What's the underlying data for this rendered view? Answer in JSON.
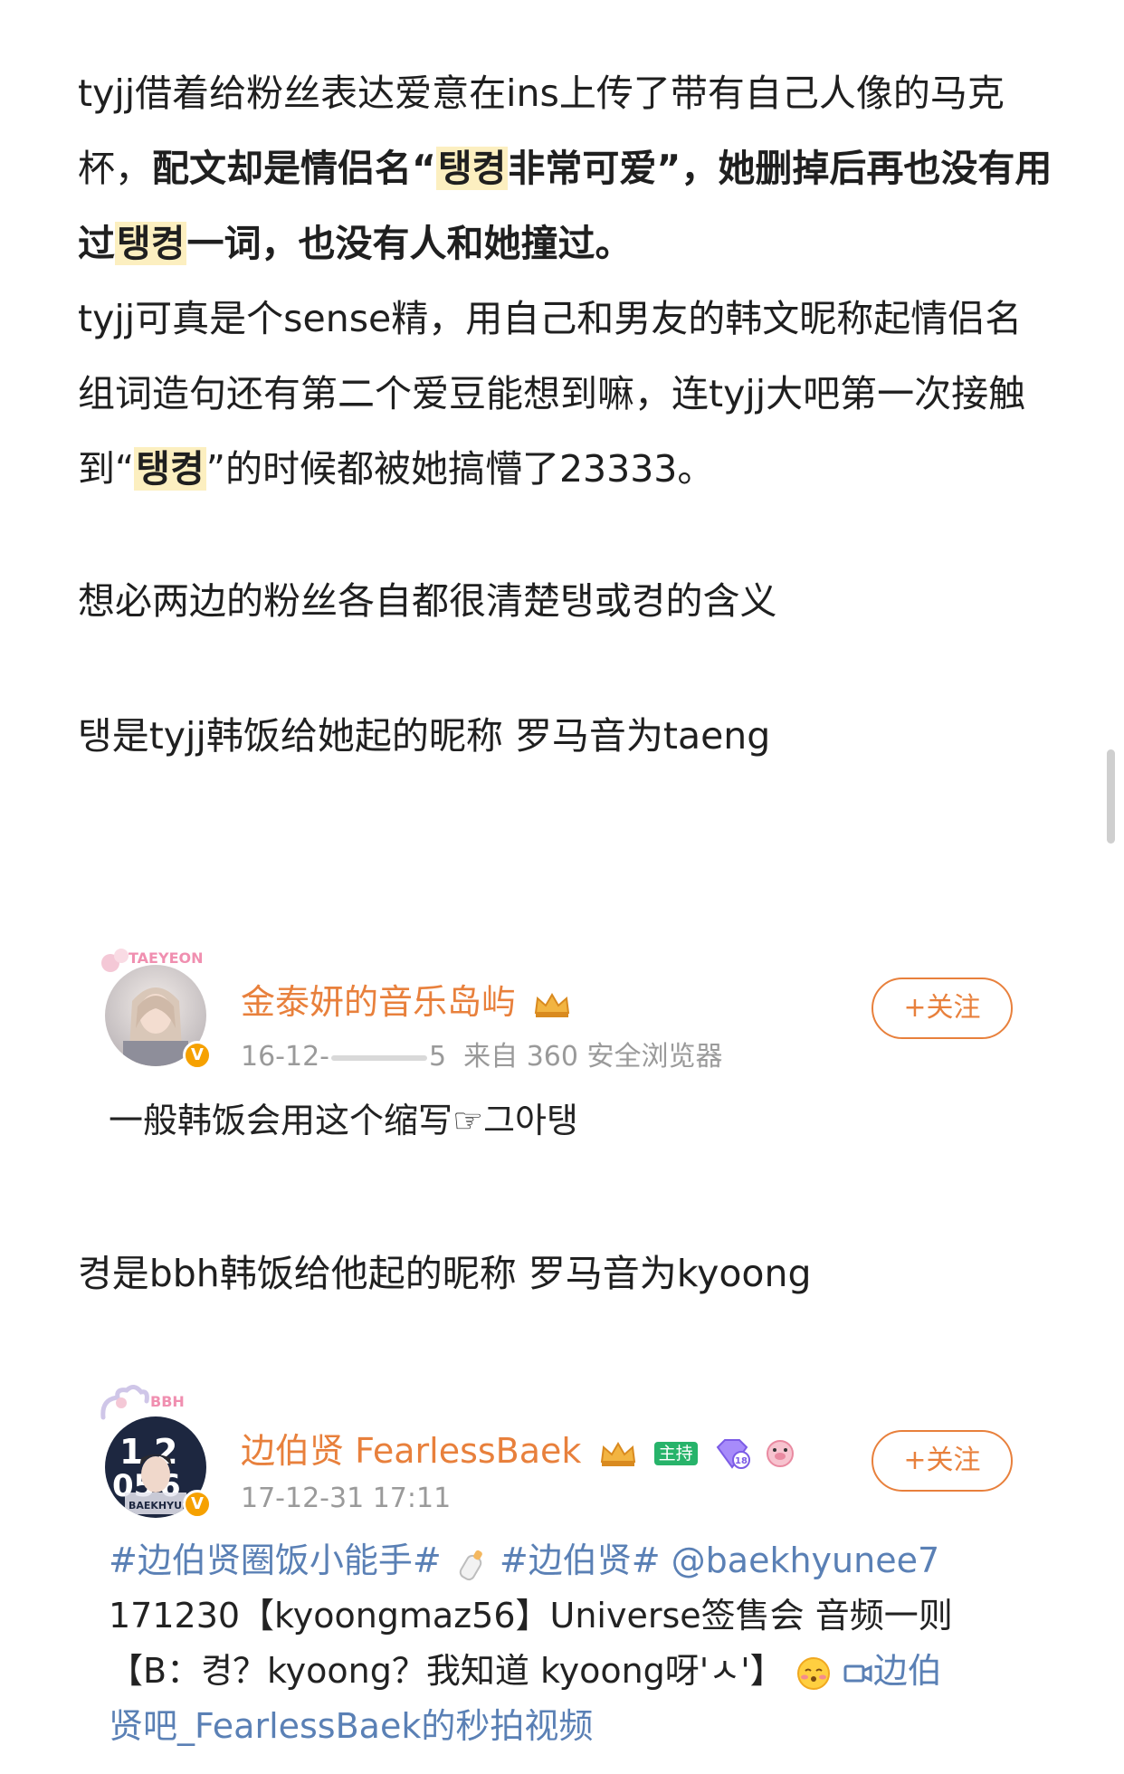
{
  "article": {
    "para1": {
      "s1": "tyjj借着给粉丝表达爱意在ins上传了带有自己人像的马克杯，",
      "b1": "配文却是情侣名“",
      "b1_hl": "탱켱",
      "b1_tail": "非常可爱”，她删掉后再也没有用过",
      "b2_hl": "탱켱",
      "b2_tail": "一词，也没有人和她撞过。",
      "s2": "tyjj可真是个sense精，用自己和男友的韩文昵称起情侣名组词造句还有第二个爱豆能想到嘛，连tyjj大吧第一次接触到“",
      "s2_hl": "탱켱",
      "s2_tail": "”的时候都被她搞懵了23333。"
    },
    "para2": "想必两边的粉丝各自都很清楚탱或켱的含义",
    "para3": "탱是tyjj韩饭给她起的昵称 罗马音为taeng",
    "para4": "켱是bbh韩饭给他起的昵称 罗马音为kyoong"
  },
  "post1": {
    "avatar_label": "TAEYEON",
    "name": "金泰妍的音乐岛屿",
    "date_prefix": "16-12-",
    "date_suffix": "5",
    "source": "来自 360 安全浏览器",
    "follow_label": "+关注",
    "text": "一般韩饭会用这个缩写☞그아탱"
  },
  "post2": {
    "avatar_label": "BBH",
    "avatar_text": "BAEKHYUN BAE",
    "name": "边伯贤 FearlessBaek",
    "host_tag": "主持",
    "gem_level": "18",
    "date": "17-12-31 17:11",
    "follow_label": "+关注",
    "hashtag1": "#边伯贤圈饭小能手#",
    "hashtag2": "#边伯贤#",
    "mention": "@baekhyunee7",
    "line2": "171230【kyoongmaz56】Universe签售会 音频一则",
    "line3": "【B：켱？kyoong？我知道 kyoong呀'ㅅ'】",
    "video_link_a": "边伯",
    "video_link_b": "贤吧_FearlessBaek的秒拍视频"
  },
  "colors": {
    "highlight": "#fcefc0",
    "username": "#e8803c",
    "link": "#5a80b5",
    "meta": "#9a9a9a",
    "vip_badge": "#f6a100",
    "host_tag": "#27b36a"
  }
}
